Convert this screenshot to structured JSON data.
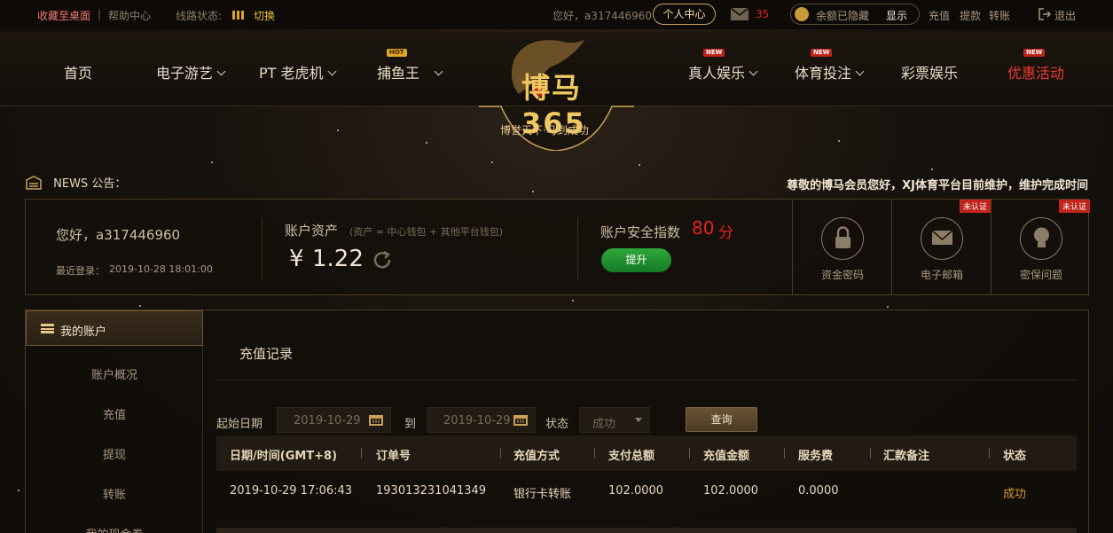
{
  "topbar": {
    "bookmark": "收藏至桌面",
    "help": "帮助中心",
    "line_status_label": "线路状态:",
    "switch": "切换",
    "greeting": "您好，a317446960",
    "user_center": "个人中心",
    "mail_count": "35",
    "balance_hidden": "余额已隐藏",
    "show": "显示",
    "deposit": "充值",
    "withdraw": "提款",
    "transfer": "转账",
    "logout": "退出"
  },
  "nav": {
    "items": [
      {
        "label": "首页"
      },
      {
        "label": "电子游艺"
      },
      {
        "label": "PT 老虎机"
      },
      {
        "label": "捕鱼王",
        "badge": "HOT"
      },
      {
        "label": "真人娱乐",
        "badge": "NEW"
      },
      {
        "label": "体育投注",
        "badge": "NEW"
      },
      {
        "label": "彩票娱乐"
      },
      {
        "label": "优惠活动",
        "badge": "NEW"
      }
    ],
    "logo_text": "博马365",
    "slogan": "博誉天下·马到成功"
  },
  "news": {
    "label": "NEWS 公告：",
    "text": "尊敬的博马会员您好，XJ体育平台目前维护，维护完成时间"
  },
  "account": {
    "greeting": "您好，a317446960",
    "last_login_label": "最近登录：",
    "last_login": "2019-10-28 18:01:00",
    "assets_label": "账户资产",
    "assets_hint": "(资产 = 中心钱包 + 其他平台钱包)",
    "currency": "¥",
    "amount": "1.22",
    "security_label": "账户安全指数",
    "security_score": "80",
    "security_unit": "分",
    "upgrade": "提升",
    "security_items": [
      {
        "label": "资金密码",
        "icon": "lock-icon"
      },
      {
        "label": "电子邮箱",
        "icon": "mail-icon",
        "tag": "未认证"
      },
      {
        "label": "密保问题",
        "icon": "bulb-icon",
        "tag": "未认证"
      }
    ]
  },
  "sidebar": {
    "title": "我的账户",
    "items": [
      "账户概况",
      "充值",
      "提现",
      "转账",
      "我的现金券"
    ]
  },
  "records": {
    "title": "充值记录",
    "start_label": "起始日期",
    "start_date": "2019-10-29",
    "to_label": "到",
    "end_date": "2019-10-29",
    "status_label": "状态",
    "status_value": "成功",
    "query": "查询",
    "columns": [
      "日期/时间(GMT+8)",
      "订单号",
      "充值方式",
      "支付总额",
      "充值金额",
      "服务费",
      "汇款备注",
      "状态"
    ],
    "rows": [
      [
        "2019-10-29 17:06:43",
        "193013231041349",
        "银行卡转账",
        "102.0000",
        "102.0000",
        "0.0000",
        "",
        "成功"
      ]
    ]
  },
  "colors": {
    "gold": "#c9a25a",
    "red": "#e0241b",
    "green": "#1c8a2c",
    "success": "#d79a32"
  }
}
